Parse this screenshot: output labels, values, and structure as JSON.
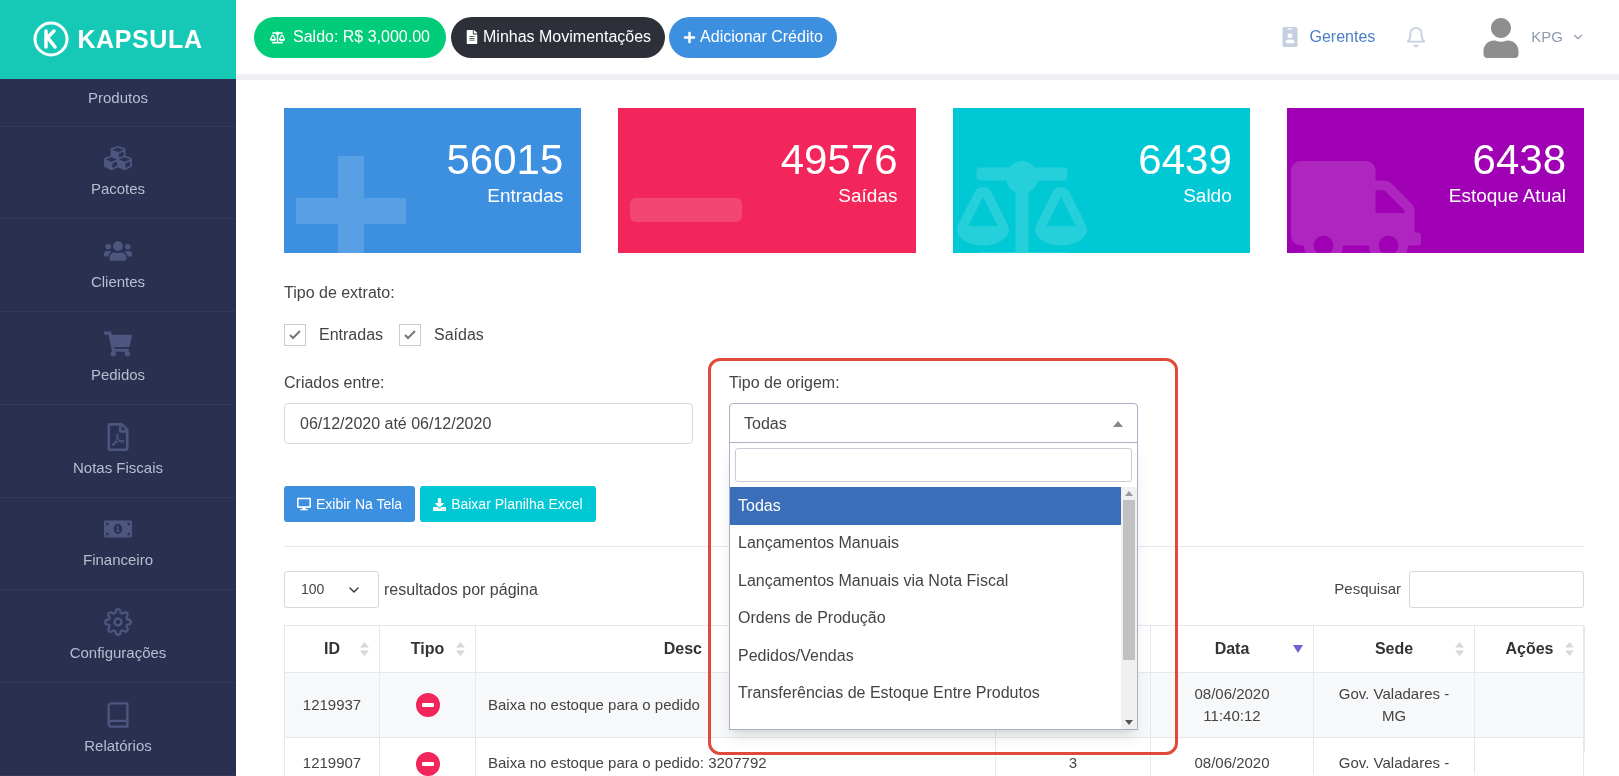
{
  "logo": {
    "text": "KAPSULA"
  },
  "header": {
    "balance_button": "Saldo: R$ 3,000.00",
    "movements_button": "Minhas Movimentações",
    "add_credit_button": "Adicionar Crédito",
    "managers_link": "Gerentes",
    "user": "KPG"
  },
  "sidebar": {
    "items": [
      {
        "label": "Produtos",
        "selected": false
      },
      {
        "label": "Pacotes",
        "selected": false
      },
      {
        "label": "Clientes",
        "selected": false
      },
      {
        "label": "Pedidos",
        "selected": false
      },
      {
        "label": "Notas Fiscais",
        "selected": false
      },
      {
        "label": "Financeiro",
        "selected": false
      },
      {
        "label": "Configurações",
        "selected": false
      },
      {
        "label": "Relatórios",
        "selected": false
      }
    ]
  },
  "cards": [
    {
      "value": "56015",
      "label": "Entradas",
      "color": "#3d8fe0"
    },
    {
      "value": "49576",
      "label": "Saídas",
      "color": "#f2265a"
    },
    {
      "value": "6439",
      "label": "Saldo",
      "color": "#00c8d4"
    },
    {
      "value": "6438",
      "label": "Estoque Atual",
      "color": "#a000b4"
    }
  ],
  "filters": {
    "statement_type_label": "Tipo de extrato:",
    "checkboxes": [
      {
        "label": "Entradas",
        "checked": true
      },
      {
        "label": "Saídas",
        "checked": true
      }
    ],
    "created_label": "Criados entre:",
    "date_range": "06/12/2020 até 06/12/2020",
    "origin_label": "Tipo de origem:",
    "origin_value": "Todas",
    "origin_options": [
      {
        "label": "Todas",
        "selected": true
      },
      {
        "label": "Lançamentos Manuais",
        "selected": false
      },
      {
        "label": "Lançamentos Manuais via Nota Fiscal",
        "selected": false
      },
      {
        "label": "Ordens de Produção",
        "selected": false
      },
      {
        "label": "Pedidos/Vendas",
        "selected": false
      },
      {
        "label": "Transferências de Estoque Entre Produtos",
        "selected": false
      }
    ]
  },
  "actions": {
    "show_button": "Exibir Na Tela",
    "download_button": "Baixar Planilha Excel"
  },
  "table": {
    "page_size": "100",
    "page_size_label": "resultados por página",
    "search_label": "Pesquisar",
    "columns": [
      {
        "label": "ID",
        "sorted": false
      },
      {
        "label": "Tipo",
        "sorted": false
      },
      {
        "label": "Desc"
      },
      {
        "label": "Data",
        "sorted": true
      },
      {
        "label": "Sede",
        "sorted": false
      },
      {
        "label": "Ações",
        "sorted": false
      }
    ],
    "rows": [
      {
        "id": "1219937",
        "kind": "outflow",
        "description": "Baixa no estoque para o pedido",
        "date": [
          "08/06/2020",
          "11:40:12"
        ],
        "branch": [
          "Gov. Valadares -",
          "MG"
        ]
      },
      {
        "id": "1219907",
        "kind": "outflow",
        "description": "Baixa no estoque para o pedido: 3207792",
        "quantity": "3",
        "date": [
          "08/06/2020"
        ],
        "branch": [
          "Gov. Valadares -"
        ]
      }
    ]
  }
}
